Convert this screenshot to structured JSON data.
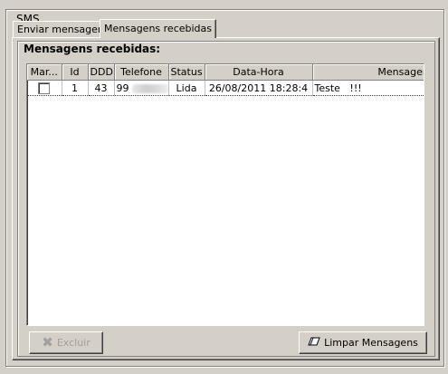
{
  "group": {
    "title": "SMS"
  },
  "tabs": [
    {
      "label": "Enviar mensagem",
      "active": false
    },
    {
      "label": "Mensagens recebidas",
      "active": true
    }
  ],
  "panel": {
    "title": "Mensagens recebidas:"
  },
  "grid": {
    "columns": [
      "Mar...",
      "Id",
      "DDD",
      "Telefone",
      "Status",
      "Data-Hora",
      "Mensagem"
    ],
    "rows": [
      {
        "marked": false,
        "id": "1",
        "ddd": "43",
        "telefone": "99",
        "status": "Lida",
        "data_hora": "26/08/2011 18:28:4",
        "mensagem": "Teste   !!!"
      }
    ]
  },
  "buttons": {
    "excluir": {
      "label": "Excluir",
      "enabled": false,
      "icon": "delete-x-icon"
    },
    "limpar": {
      "label": "Limpar Mensagens",
      "enabled": true,
      "icon": "eraser-icon"
    }
  },
  "colors": {
    "face": "#d4d0c8",
    "disabled_text": "#a0a0a0"
  }
}
